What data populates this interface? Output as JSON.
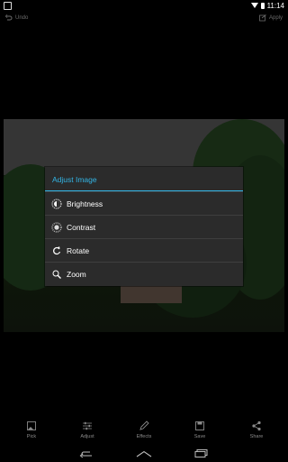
{
  "status": {
    "time": "11:14"
  },
  "actionbar": {
    "undo_label": "Undo",
    "apply_label": "Apply"
  },
  "dialog": {
    "title": "Adjust Image",
    "items": [
      {
        "label": "Brightness",
        "icon": "brightness-icon"
      },
      {
        "label": "Contrast",
        "icon": "contrast-icon"
      },
      {
        "label": "Rotate",
        "icon": "rotate-icon"
      },
      {
        "label": "Zoom",
        "icon": "zoom-icon"
      }
    ]
  },
  "bottombar": {
    "items": [
      {
        "label": "Pick",
        "icon": "image-icon"
      },
      {
        "label": "Adjust",
        "icon": "sliders-icon"
      },
      {
        "label": "Effects",
        "icon": "pencil-icon"
      },
      {
        "label": "Save",
        "icon": "save-icon"
      },
      {
        "label": "Share",
        "icon": "share-icon"
      }
    ]
  },
  "colors": {
    "accent": "#33b5e5",
    "dialog_bg": "#2b2b2b",
    "inactive": "#8a8a8a"
  }
}
